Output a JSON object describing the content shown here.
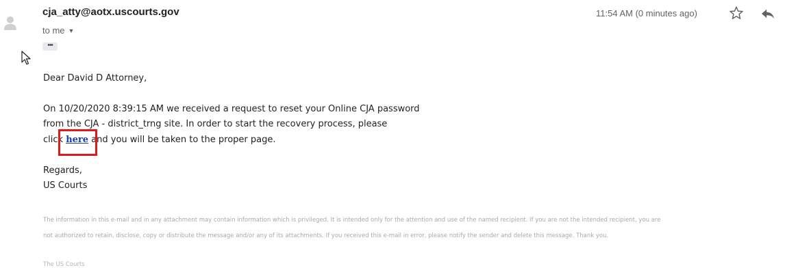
{
  "header": {
    "sender": "cja_atty@aotx.uscourts.gov",
    "recipient_label": "to me",
    "timestamp": "11:54 AM (0 minutes ago)"
  },
  "icons": {
    "avatar": "person-icon",
    "expand": "more-dots-icon",
    "star": "star-icon",
    "reply": "reply-icon",
    "cursor": "mouse-pointer-icon"
  },
  "body": {
    "greeting": "Dear David D Attorney,",
    "para_line1": "On 10/20/2020 8:39:15 AM we received a request to reset your Online CJA password",
    "para_line2": "from the CJA - district_trng site. In order to start the recovery process, please",
    "para_line3_pre": "click ",
    "link_text": "here",
    "para_line3_post": " and you will be taken to the proper page.",
    "closing": "Regards,",
    "signature": "US Courts"
  },
  "disclaimer": {
    "line1": "The information in this e-mail and in any attachment may contain information which is privileged. It is intended only for the attention and use of the named recipient. If you are not the intended recipient, you are",
    "line2": "not authorized to retain, disclose, copy or distribute the message and/or any of its attachments. If you received this e-mail in error, please notify the sender and delete this message. Thank you.",
    "signoff": "The US Courts"
  },
  "colors": {
    "link": "#1a3fae",
    "highlight_box": "#e0191f"
  }
}
